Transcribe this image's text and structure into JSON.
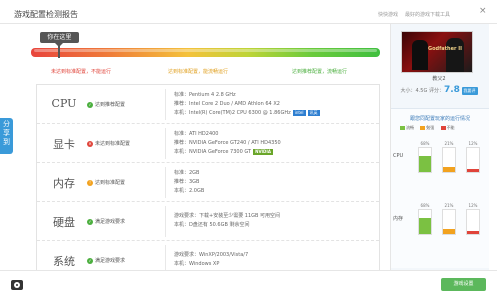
{
  "header": {
    "title": "游戏配置检测报告",
    "link1": "快快游戏",
    "link2": "最好的游戏下载工具",
    "close_glyph": "×"
  },
  "side_tab": {
    "label": "分享到"
  },
  "gauge": {
    "marker_label": "你在这里",
    "position_percent": 8,
    "labels": [
      {
        "text": "未达到标准配置，不能运行",
        "color": "#e0443a"
      },
      {
        "text": "达到标准配置，能流畅运行",
        "color": "#e0a020"
      },
      {
        "text": "达到推荐配置，流畅运行",
        "color": "#4caf3f"
      }
    ]
  },
  "rows": [
    {
      "category": "CPU",
      "status_kind": "ok",
      "status_text": "达到推荐配置",
      "standard": "标准：Pentium 4 2.8 GHz",
      "recommended": "推荐：Intel Core 2 Duo / AMD Athlon 64 X2",
      "mine": "本机：Intel(R) Core(TM)2 CPU 6300 @ 1.86GHz",
      "brand_badge": "intel",
      "brand_badge_2": "讯英"
    },
    {
      "category": "显卡",
      "status_kind": "bad",
      "status_text": "未达到标准配置",
      "standard": "标准：ATI HD2400",
      "recommended": "推荐：NVIDIA GeForce GT240 / ATI HD4350",
      "mine": "本机：NVIDIA GeForce 7300 GT",
      "brand_badge": "NVIDIA"
    },
    {
      "category": "内存",
      "status_kind": "warn",
      "status_text": "达到标准配置",
      "standard": "标准：2GB",
      "recommended": "推荐：3GB",
      "mine": "本机：2.0GB"
    },
    {
      "category": "硬盘",
      "status_kind": "ok",
      "status_text": "满足游戏要求",
      "standard": "游戏要求：下载+安装至少需要 11GB 可用空间",
      "mine": "本机：D盘还有 50.6GB 剩余空间"
    },
    {
      "category": "系统",
      "status_kind": "ok",
      "status_text": "满足游戏要求",
      "standard": "游戏要求：WinXP/2003/Vista/7",
      "mine": "本机：Windows XP"
    }
  ],
  "game": {
    "poster_title": "Godfather II",
    "name": "教父2",
    "size_label": "大小：",
    "size_value": "4.5G",
    "rating_label": "评分：",
    "rating_value": "7.8",
    "rate_button": "我要评"
  },
  "stats": {
    "title": "跟您同配置玩家的运行情况",
    "legend": [
      {
        "label": "流畅",
        "color": "#7bc142"
      },
      {
        "label": "勉强",
        "color": "#f2a21f"
      },
      {
        "label": "不能",
        "color": "#e0443a"
      }
    ],
    "chart_data": {
      "type": "bar",
      "categories": [
        "流畅",
        "勉强",
        "不能"
      ],
      "series": [
        {
          "name": "CPU",
          "values": [
            68,
            21,
            12
          ]
        },
        {
          "name": "内存",
          "values": [
            68,
            21,
            12
          ]
        }
      ],
      "ylim": [
        0,
        100
      ]
    }
  },
  "footer": {
    "start_button": "游戏设置"
  }
}
